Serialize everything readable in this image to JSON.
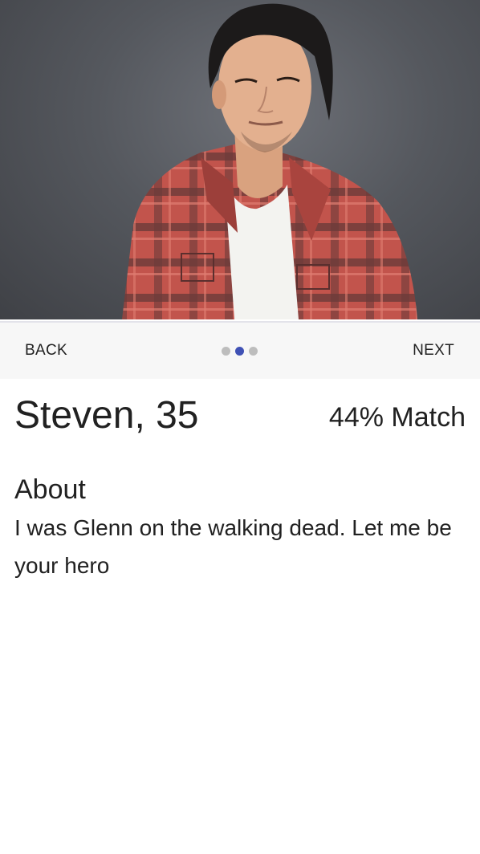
{
  "profile": {
    "photo_icon": "profile-photo",
    "name_age": "Steven, 35",
    "match": "44% Match",
    "about_title": "About",
    "about_text": "I was Glenn on the walking dead. Let me be your hero"
  },
  "stepper": {
    "back_label": "BACK",
    "next_label": "NEXT",
    "total_steps": 3,
    "active_step": 2,
    "active_color": "#3f51b5",
    "inactive_color": "#bdbdbd"
  }
}
